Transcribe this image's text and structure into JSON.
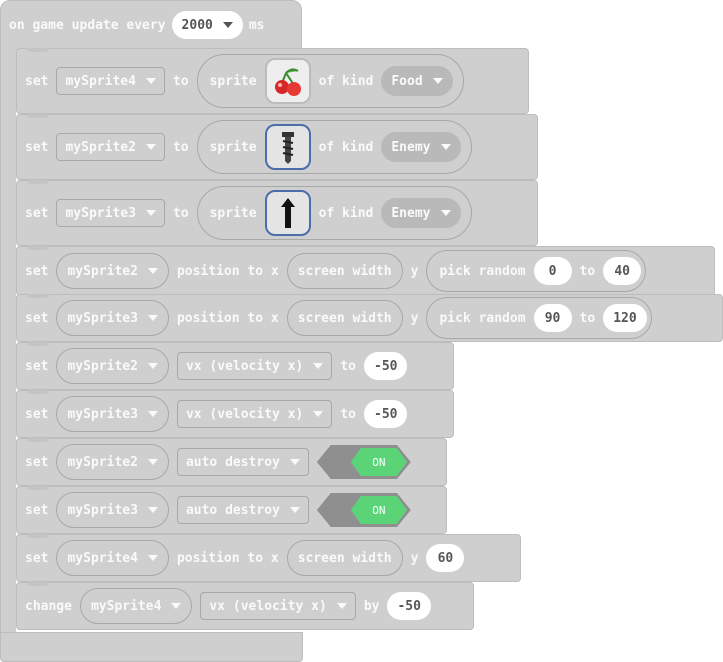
{
  "event": {
    "prefix": "on game update every",
    "interval": "2000",
    "suffix": "ms"
  },
  "kw": {
    "set": "set",
    "to": "to",
    "sprite": "sprite",
    "of_kind": "of kind",
    "position_to_x": "position to x",
    "y": "y",
    "by": "by",
    "change": "change",
    "pick_random": "pick random"
  },
  "blocks": {
    "b1": {
      "var": "mySprite4",
      "kind": "Food",
      "image": "cherry"
    },
    "b2": {
      "var": "mySprite2",
      "kind": "Enemy",
      "image": "bolt"
    },
    "b3": {
      "var": "mySprite3",
      "kind": "Enemy",
      "image": "arrow"
    },
    "b4": {
      "var": "mySprite2",
      "x": "screen width",
      "min": "0",
      "max": "40"
    },
    "b5": {
      "var": "mySprite3",
      "x": "screen width",
      "min": "90",
      "max": "120"
    },
    "b6": {
      "var": "mySprite2",
      "prop": "vx (velocity x)",
      "value": "-50"
    },
    "b7": {
      "var": "mySprite3",
      "prop": "vx (velocity x)",
      "value": "-50"
    },
    "b8": {
      "var": "mySprite2",
      "prop": "auto destroy",
      "toggle": "ON"
    },
    "b9": {
      "var": "mySprite3",
      "prop": "auto destroy",
      "toggle": "ON"
    },
    "b10": {
      "var": "mySprite4",
      "x": "screen width",
      "y": "60"
    },
    "b11": {
      "var": "mySprite4",
      "prop": "vx (velocity x)",
      "value": "-50"
    }
  },
  "colors": {
    "block": "#cfcfcf",
    "toggle_on": "#5ad477",
    "selected_border": "#4c6dab"
  }
}
